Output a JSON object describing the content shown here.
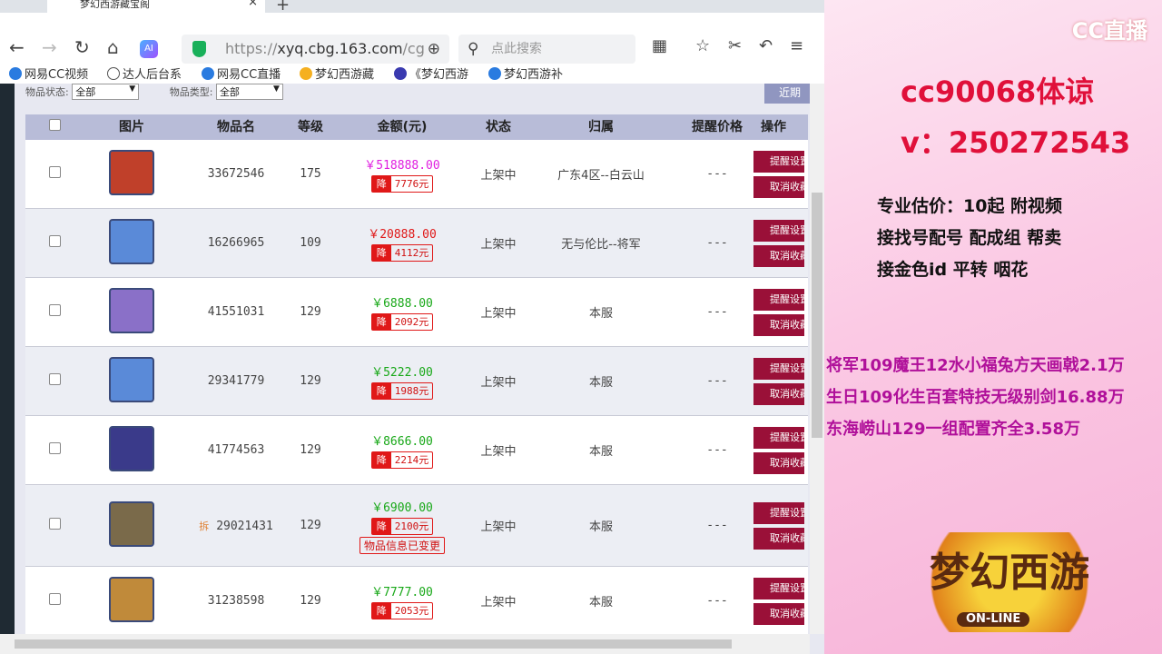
{
  "browser": {
    "tab_title": "梦幻西游藏宝阁",
    "url_host": "xyq.cbg.163.com",
    "url_prefix": "https://",
    "url_suffix": "/cg",
    "search_placeholder": "点此搜索",
    "ai_label": "AI"
  },
  "bookmarks": [
    "网易CC视频",
    "达人后台系",
    "网易CC直播",
    "梦幻西游藏",
    "《梦幻西游",
    "梦幻西游补"
  ],
  "filters": {
    "status_label": "物品状态:",
    "status_value": "全部",
    "type_label": "物品类型:",
    "type_value": "全部",
    "recent_button": "近期"
  },
  "table": {
    "headers": [
      "图片",
      "物品名",
      "等级",
      "金额(元)",
      "状态",
      "归属",
      "提醒价格",
      "操作"
    ],
    "remind_btn": "提醒设置",
    "cancel_btn": "取消收藏",
    "rows": [
      {
        "id": "33672546",
        "level": "175",
        "price": "￥518888.00",
        "price_color": "#e020e0",
        "drop": "7776元",
        "status": "上架中",
        "server": "广东4区--白云山",
        "remind": "---"
      },
      {
        "id": "16266965",
        "level": "109",
        "price": "￥20888.00",
        "price_color": "#e01818",
        "drop": "4112元",
        "status": "上架中",
        "server": "无与伦比--将军",
        "remind": "---"
      },
      {
        "id": "41551031",
        "level": "129",
        "price": "￥6888.00",
        "price_color": "#18a818",
        "drop": "2092元",
        "status": "上架中",
        "server": "本服",
        "remind": "---"
      },
      {
        "id": "29341779",
        "level": "129",
        "price": "￥5222.00",
        "price_color": "#18a818",
        "drop": "1988元",
        "status": "上架中",
        "server": "本服",
        "remind": "---"
      },
      {
        "id": "41774563",
        "level": "129",
        "price": "￥8666.00",
        "price_color": "#18a818",
        "drop": "2214元",
        "status": "上架中",
        "server": "本服",
        "remind": "---"
      },
      {
        "id": "29021431",
        "tag": "拆",
        "level": "129",
        "price": "￥6900.00",
        "price_color": "#18a818",
        "drop": "2100元",
        "changed": "物品信息已变更",
        "status": "上架中",
        "server": "本服",
        "remind": "---"
      },
      {
        "id": "31238598",
        "level": "129",
        "price": "￥7777.00",
        "price_color": "#18a818",
        "drop": "2053元",
        "status": "上架中",
        "server": "本服",
        "remind": "---"
      }
    ],
    "drop_label": "降"
  },
  "overlay": {
    "brand": "CC直播",
    "contact1": "cc90068体谅",
    "contact2": "v：250272543",
    "info": [
      "专业估价：10起  附视频",
      "接找号配号 配成组 帮卖",
      "接金色id 平转 咽花"
    ],
    "promos": [
      "将军109魔王12水小福兔方天画戟2.1万",
      "生日109化生百套特技无级别剑16.88万",
      "东海崂山129一组配置齐全3.58万"
    ],
    "game_logo": "梦幻西游",
    "game_logo_sub": "ON-LINE"
  }
}
